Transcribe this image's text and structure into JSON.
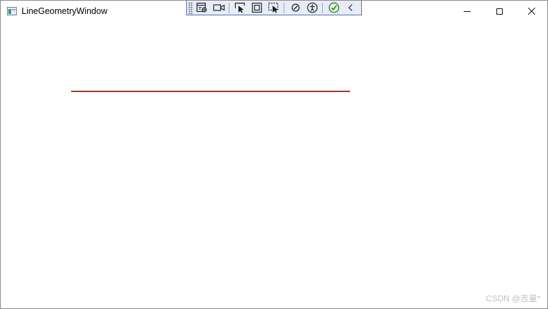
{
  "window": {
    "title": "LineGeometryWindow"
  },
  "caption_buttons": {
    "minimize_icon": "minimize-icon",
    "maximize_icon": "maximize-icon",
    "close_icon": "close-icon"
  },
  "debug_toolbar": {
    "tools": [
      "go-to-live-visual-tree-icon",
      "record-icon",
      "select-element-icon",
      "display-layout-adorners-icon",
      "track-focused-element-icon",
      "binding-failures-icon",
      "accessibility-icon",
      "no-issues-icon",
      "collapse-toolbar-icon"
    ]
  },
  "line": {
    "stroke": "#e31b0e"
  },
  "watermark": {
    "text": "CSDN @吉量*"
  }
}
